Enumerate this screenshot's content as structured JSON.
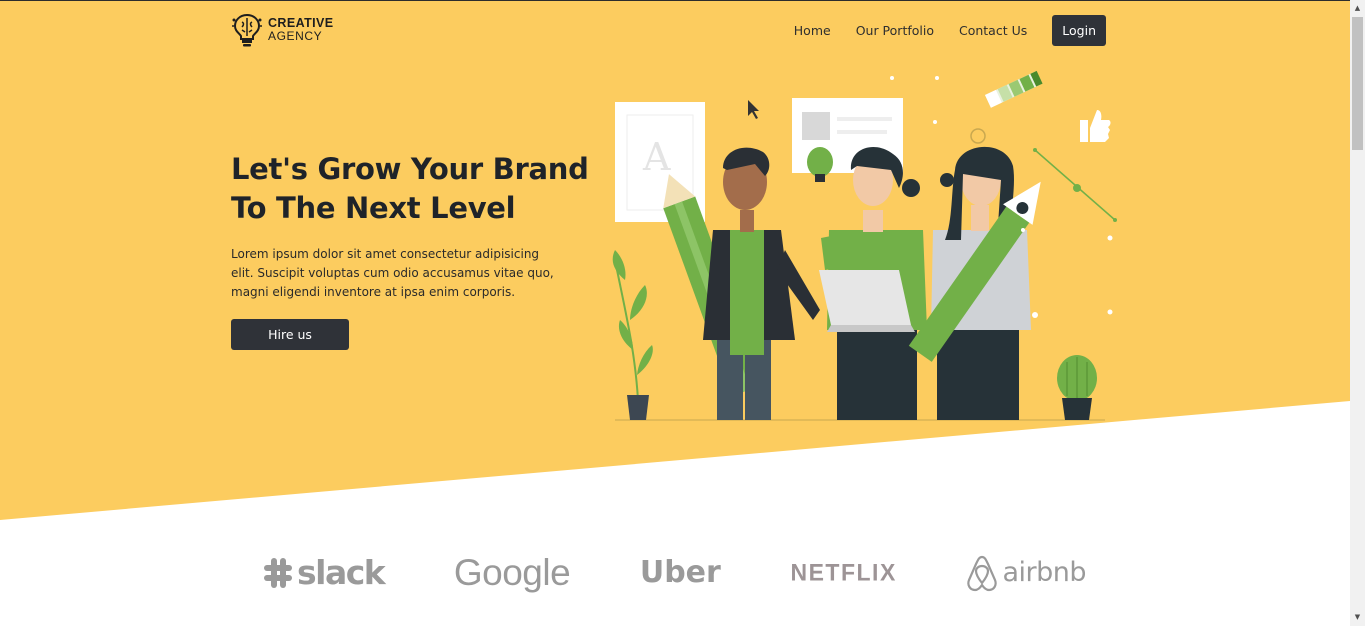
{
  "colors": {
    "hero_background": "#fccc5f",
    "dark_button": "#2f3238",
    "accent_green": "#72b048",
    "logo_gray": "#9a9a9a"
  },
  "brand": {
    "icon": "lightbulb-brain-icon",
    "line1": "CREATIVE",
    "line2": "AGENCY"
  },
  "nav": {
    "links": [
      "Home",
      "Our Portfolio",
      "Contact Us"
    ],
    "login": "Login"
  },
  "hero": {
    "title": "Let's Grow Your Brand To The Next Level",
    "text": "Lorem ipsum dolor sit amet consectetur adipisicing elit. Suscipit voluptas cum odio accusamus vitae quo, magni eligendi inventore at ipsa enim corporis.",
    "button": "Hire us",
    "illustration": "team-creative-illustration"
  },
  "partners": {
    "slack": "slack",
    "google": "Google",
    "uber": "Uber",
    "netflix": "NETFLIX",
    "airbnb": "airbnb"
  },
  "scrollbar": {
    "up_icon": "scroll-up-arrow-icon",
    "down_icon": "scroll-down-arrow-icon"
  }
}
